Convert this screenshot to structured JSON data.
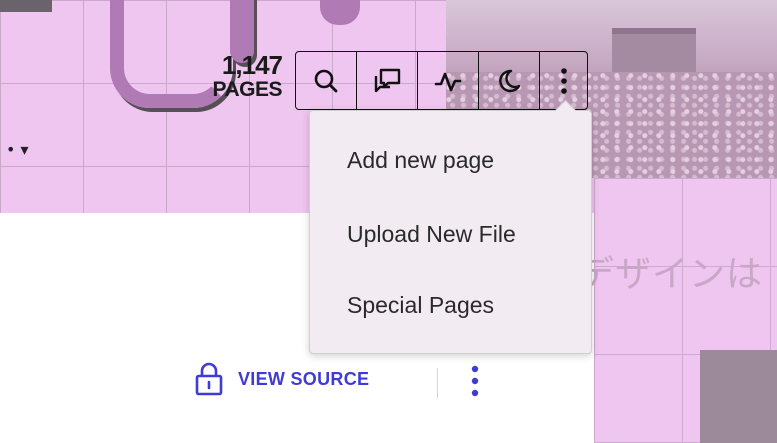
{
  "header": {
    "page_count": "1,147",
    "page_count_label": "PAGES"
  },
  "toolbar": {
    "buttons": [
      {
        "icon": "search-icon"
      },
      {
        "icon": "discussion-icon"
      },
      {
        "icon": "activity-icon"
      },
      {
        "icon": "moon-icon"
      },
      {
        "icon": "more-vertical-icon"
      }
    ]
  },
  "menu": {
    "items": [
      {
        "label": "Add new page"
      },
      {
        "label": "Upload New File"
      },
      {
        "label": "Special Pages"
      }
    ]
  },
  "actions": {
    "view_source_label": "VIEW SOURCE"
  },
  "background": {
    "jp_text": "デザインは"
  },
  "colors": {
    "accent": "#3f3bd6",
    "background": "#efc6ef",
    "menu_bg": "#f2ecf2"
  }
}
